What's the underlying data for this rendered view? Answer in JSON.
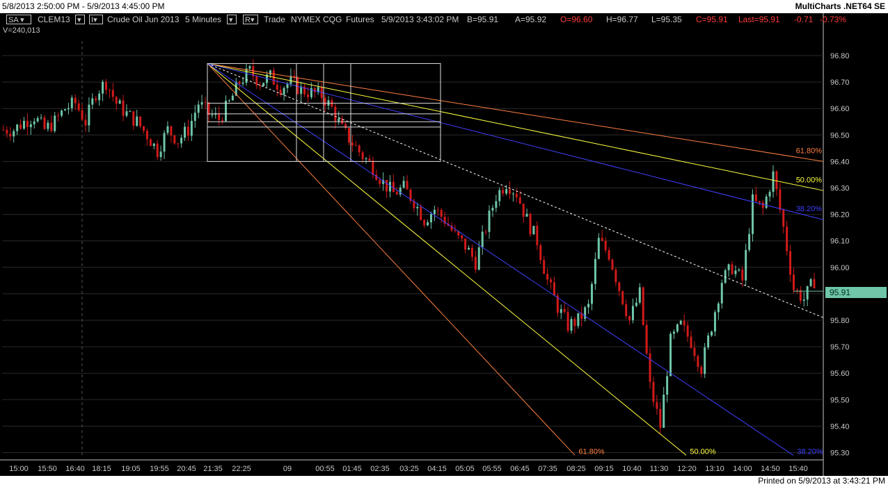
{
  "window": {
    "title_range": "5/8/2013 2:50:00 PM - 5/9/2013 4:45:00 PM",
    "app_name": "MultiCharts .NET64 SE"
  },
  "toolbar": {
    "mode": "SA",
    "symbol": "CLEM13",
    "interval_button": "I",
    "description": "Crude Oil Jun 2013",
    "resolution": "5 Minutes",
    "r_button": "R",
    "data_type": "Trade",
    "exchange": "NYMEX",
    "feed": "CQG",
    "category": "Futures",
    "datetime": "5/9/2013 3:43:02 PM",
    "bid": "B=95.91",
    "ask": "A=95.92",
    "open": "O=96.60",
    "high": "H=96.77",
    "low": "L=95.35",
    "close": "C=95.91",
    "last": "Last=95.91",
    "change": "-0.71",
    "change_pct": "-0.73%",
    "volume": "V=240,013"
  },
  "footer": {
    "printed": "Printed on 5/9/2013 at 3:43:21 PM"
  },
  "colors": {
    "background": "#000000",
    "up_candle": "#6fc6a8",
    "down_candle": "#d21a1a",
    "fib_618": "#ff8040",
    "fib_500": "#ffff40",
    "fib_382": "#4040ff",
    "dotted": "#ffffff"
  },
  "chart_data": {
    "type": "candlestick",
    "symbol": "CLEM13",
    "ylim": [
      95.25,
      96.86
    ],
    "y_ticks": [
      "96.80",
      "96.70",
      "96.60",
      "96.50",
      "96.40",
      "96.30",
      "96.20",
      "96.10",
      "96.00",
      "95.90",
      "95.80",
      "95.70",
      "95.60",
      "95.50",
      "95.40",
      "95.30"
    ],
    "x_ticks": [
      "15:00",
      "15:50",
      "16:40",
      "18:15",
      "19:05",
      "19:55",
      "20:45",
      "21:35",
      "22:25",
      "09",
      "00:55",
      "01:45",
      "02:35",
      "03:25",
      "04:15",
      "05:05",
      "05:55",
      "06:45",
      "07:35",
      "08:25",
      "09:15",
      "10:40",
      "11:30",
      "12:20",
      "13:10",
      "14:00",
      "14:50",
      "15:40"
    ],
    "session_divider": "16:40",
    "last_price": "95.91",
    "fan_anchor": {
      "bar": 0,
      "price": 96.77
    },
    "upper_fan": [
      {
        "label": "61.80%",
        "end_price": 96.4
      },
      {
        "label": "50.00%",
        "end_price": 96.29
      },
      {
        "label": "38.20%",
        "end_price": 96.18
      },
      {
        "label": "",
        "end_price": 95.81
      }
    ],
    "lower_fan": [
      {
        "label": "61.80%",
        "end_price": 95.29
      },
      {
        "label": "50.00%",
        "end_price": 95.29
      },
      {
        "label": "38.20%",
        "end_price": 95.29
      }
    ],
    "fan_box": {
      "high": 96.77,
      "low": 96.4
    },
    "fan_box_levels": [
      96.62,
      96.58,
      96.55,
      96.53
    ],
    "close_path": [
      [
        0,
        96.52
      ],
      [
        3,
        96.52
      ],
      [
        6,
        96.55
      ],
      [
        9,
        96.57
      ],
      [
        12,
        96.52
      ],
      [
        15,
        96.55
      ],
      [
        18,
        96.6
      ],
      [
        21,
        96.62
      ],
      [
        24,
        96.55
      ],
      [
        27,
        96.66
      ],
      [
        30,
        96.7
      ],
      [
        33,
        96.62
      ],
      [
        36,
        96.58
      ],
      [
        39,
        96.55
      ],
      [
        42,
        96.5
      ],
      [
        45,
        96.44
      ],
      [
        48,
        96.52
      ],
      [
        51,
        96.48
      ],
      [
        54,
        96.52
      ],
      [
        57,
        96.62
      ],
      [
        60,
        96.58
      ],
      [
        63,
        96.56
      ],
      [
        66,
        96.62
      ],
      [
        69,
        96.7
      ],
      [
        72,
        96.74
      ],
      [
        75,
        96.7
      ],
      [
        78,
        96.72
      ],
      [
        81,
        96.68
      ],
      [
        84,
        96.7
      ],
      [
        87,
        96.67
      ],
      [
        90,
        96.66
      ],
      [
        93,
        96.65
      ],
      [
        96,
        96.6
      ],
      [
        99,
        96.52
      ],
      [
        102,
        96.47
      ],
      [
        105,
        96.42
      ],
      [
        108,
        96.38
      ],
      [
        111,
        96.32
      ],
      [
        114,
        96.28
      ],
      [
        117,
        96.3
      ],
      [
        120,
        96.25
      ],
      [
        123,
        96.18
      ],
      [
        126,
        96.22
      ],
      [
        129,
        96.18
      ],
      [
        132,
        96.12
      ],
      [
        135,
        96.08
      ],
      [
        138,
        96.02
      ],
      [
        141,
        96.15
      ],
      [
        144,
        96.27
      ],
      [
        147,
        96.32
      ],
      [
        150,
        96.28
      ],
      [
        153,
        96.18
      ],
      [
        156,
        96.1
      ],
      [
        159,
        95.95
      ],
      [
        162,
        95.85
      ],
      [
        165,
        95.78
      ],
      [
        168,
        95.8
      ],
      [
        171,
        95.85
      ],
      [
        174,
        96.1
      ],
      [
        177,
        96.05
      ],
      [
        180,
        95.92
      ],
      [
        183,
        95.8
      ],
      [
        186,
        95.9
      ],
      [
        189,
        95.55
      ],
      [
        192,
        95.4
      ],
      [
        195,
        95.72
      ],
      [
        198,
        95.78
      ],
      [
        201,
        95.72
      ],
      [
        204,
        95.62
      ],
      [
        207,
        95.78
      ],
      [
        210,
        95.95
      ],
      [
        213,
        96.0
      ],
      [
        216,
        95.95
      ],
      [
        219,
        96.25
      ],
      [
        222,
        96.22
      ],
      [
        225,
        96.35
      ],
      [
        228,
        96.15
      ],
      [
        231,
        95.92
      ],
      [
        234,
        95.88
      ],
      [
        237,
        95.95
      ]
    ]
  }
}
